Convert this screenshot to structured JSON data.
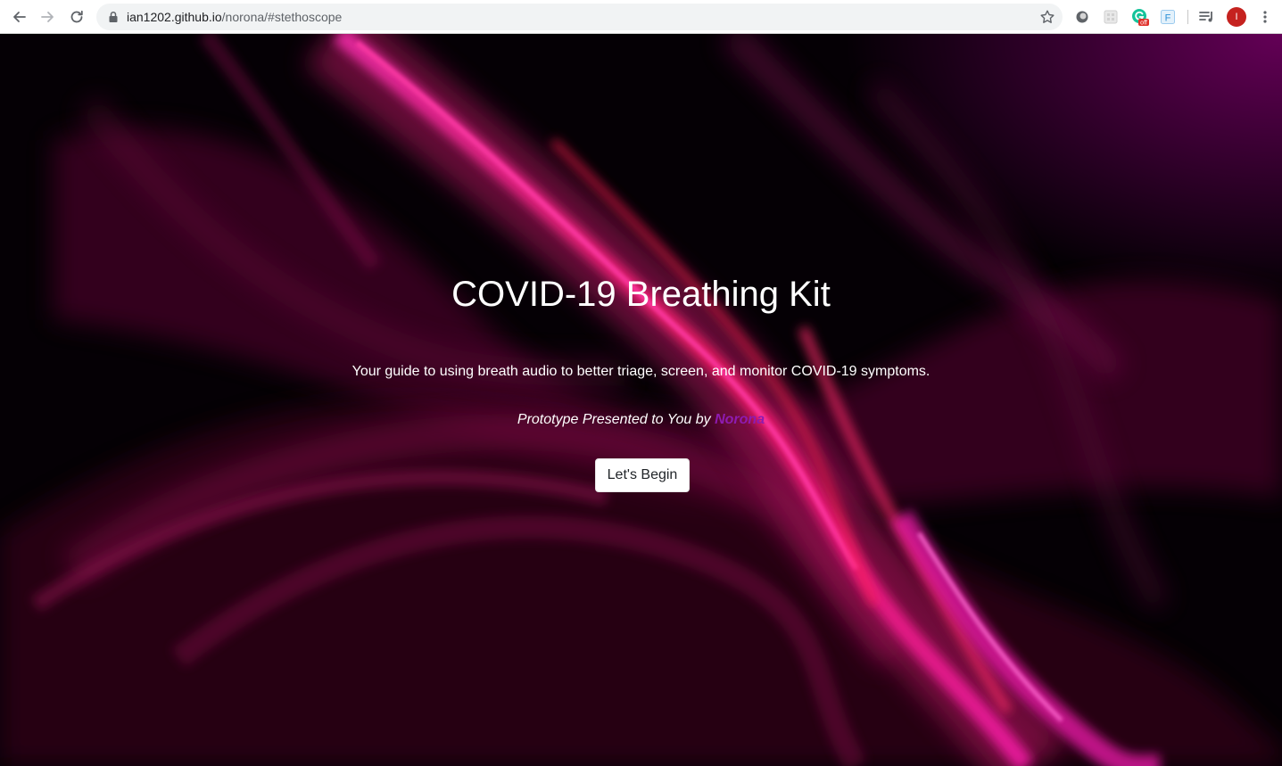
{
  "browser": {
    "url_host": "ian1202.github.io",
    "url_path": "/norona/#stethoscope",
    "avatar_letter": "I",
    "extensions": [
      "extension-circle-icon",
      "extension-grid-icon",
      "grammarly-icon",
      "extension-f-icon"
    ],
    "grammarly_badge": "off",
    "ext_f_letter": "F"
  },
  "hero": {
    "title": "COVID-19 Breathing Kit",
    "subtitle": "Your guide to using breath audio to better triage, screen, and monitor COVID-19 symptoms.",
    "credit_prefix": "Prototype Presented to You by ",
    "credit_brand": "Norona",
    "brand_color": "#8e1bb0",
    "cta_label": "Let's Begin"
  }
}
